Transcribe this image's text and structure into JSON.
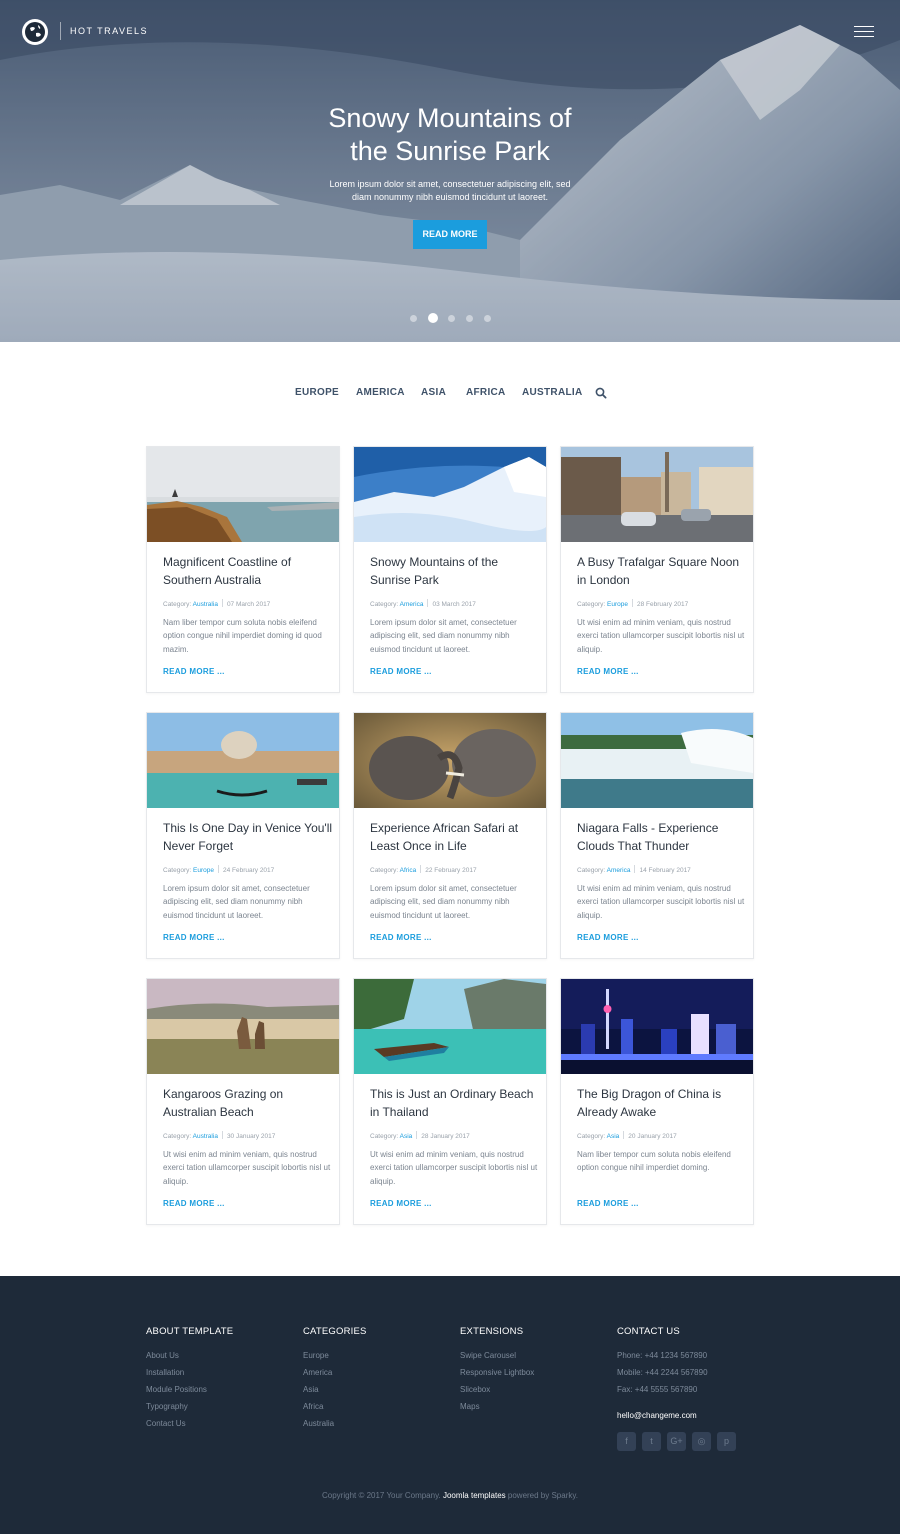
{
  "header": {
    "brand": "HOT TRAVELS",
    "logo_icon": "globe-icon",
    "menu_icon": "hamburger-menu-icon"
  },
  "hero": {
    "title_line1": "Snowy Mountains of",
    "title_line2": "the Sunrise Park",
    "text": "Lorem ipsum dolor sit amet, consectetuer adipiscing elit, sed diam nonummy nibh euismod tincidunt ut laoreet.",
    "button": "READ MORE",
    "slide_count": 5,
    "active_slide": 2
  },
  "nav": {
    "items": [
      "EUROPE",
      "AMERICA",
      "ASIA",
      "AFRICA",
      "AUSTRALIA"
    ],
    "search_icon": "search-icon"
  },
  "labels": {
    "category": "Category:",
    "read_more": "READ MORE ..."
  },
  "articles": [
    {
      "title": "Magnificent Coastline of Southern Australia",
      "category": "Australia",
      "date": "07 March 2017",
      "excerpt": "Nam liber tempor cum soluta nobis eleifend option congue nihil imperdiet doming id quod mazim."
    },
    {
      "title": "Snowy Mountains of the Sunrise Park",
      "category": "America",
      "date": "03 March 2017",
      "excerpt": "Lorem ipsum dolor sit amet, consectetuer adipiscing elit, sed diam nonummy nibh euismod tincidunt ut laoreet."
    },
    {
      "title": "A Busy Trafalgar Square Noon in London",
      "category": "Europe",
      "date": "28 February 2017",
      "excerpt": "Ut wisi enim ad minim veniam, quis nostrud exerci tation ullamcorper suscipit lobortis nisl ut aliquip."
    },
    {
      "title": "This Is One Day in Venice You'll Never Forget",
      "category": "Europe",
      "date": "24 February 2017",
      "excerpt": "Lorem ipsum dolor sit amet, consectetuer adipiscing elit, sed diam nonummy nibh euismod tincidunt ut laoreet."
    },
    {
      "title": "Experience African Safari at Least Once in Life",
      "category": "Africa",
      "date": "22 February 2017",
      "excerpt": "Lorem ipsum dolor sit amet, consectetuer adipiscing elit, sed diam nonummy nibh euismod tincidunt ut laoreet."
    },
    {
      "title": "Niagara Falls - Experience Clouds That Thunder",
      "category": "America",
      "date": "14 February 2017",
      "excerpt": "Ut wisi enim ad minim veniam, quis nostrud exerci tation ullamcorper suscipit lobortis nisl ut aliquip."
    },
    {
      "title": "Kangaroos Grazing on Australian Beach",
      "category": "Australia",
      "date": "30 January 2017",
      "excerpt": "Ut wisi enim ad minim veniam, quis nostrud exerci tation ullamcorper suscipit lobortis nisl ut aliquip."
    },
    {
      "title": "This is Just an Ordinary Beach in Thailand",
      "category": "Asia",
      "date": "28 January 2017",
      "excerpt": "Ut wisi enim ad minim veniam, quis nostrud exerci tation ullamcorper suscipit lobortis nisl ut aliquip."
    },
    {
      "title": "The Big Dragon of China is Already Awake",
      "category": "Asia",
      "date": "20 January 2017",
      "excerpt": "Nam liber tempor cum soluta nobis eleifend option congue nihil imperdiet doming."
    }
  ],
  "footer": {
    "about": {
      "heading": "ABOUT TEMPLATE",
      "links": [
        "About Us",
        "Installation",
        "Module Positions",
        "Typography",
        "Contact Us"
      ]
    },
    "categories": {
      "heading": "CATEGORIES",
      "links": [
        "Europe",
        "America",
        "Asia",
        "Africa",
        "Australia"
      ]
    },
    "extensions": {
      "heading": "EXTENSIONS",
      "links": [
        "Swipe Carousel",
        "Responsive Lightbox",
        "Slicebox",
        "Maps"
      ]
    },
    "contact": {
      "heading": "CONTACT US",
      "phone": "Phone: +44 1234 567890",
      "mobile": "Mobile: +44 2244 567890",
      "fax": "Fax: +44 5555 567890",
      "email": "hello@changeme.com"
    },
    "socials": [
      {
        "icon": "facebook-icon",
        "glyph": "f"
      },
      {
        "icon": "twitter-icon",
        "glyph": "t"
      },
      {
        "icon": "google-plus-icon",
        "glyph": "G+"
      },
      {
        "icon": "instagram-icon",
        "glyph": "◎"
      },
      {
        "icon": "pinterest-icon",
        "glyph": "p"
      }
    ],
    "copyright_prefix": "Copyright © 2017 Your Company.",
    "copyright_link": "Joomla templates",
    "copyright_suffix": "powered by Sparky."
  },
  "colors": {
    "accent": "#1b9ddd",
    "footer_bg": "#1e2a39",
    "nav_text": "#3f5269"
  }
}
